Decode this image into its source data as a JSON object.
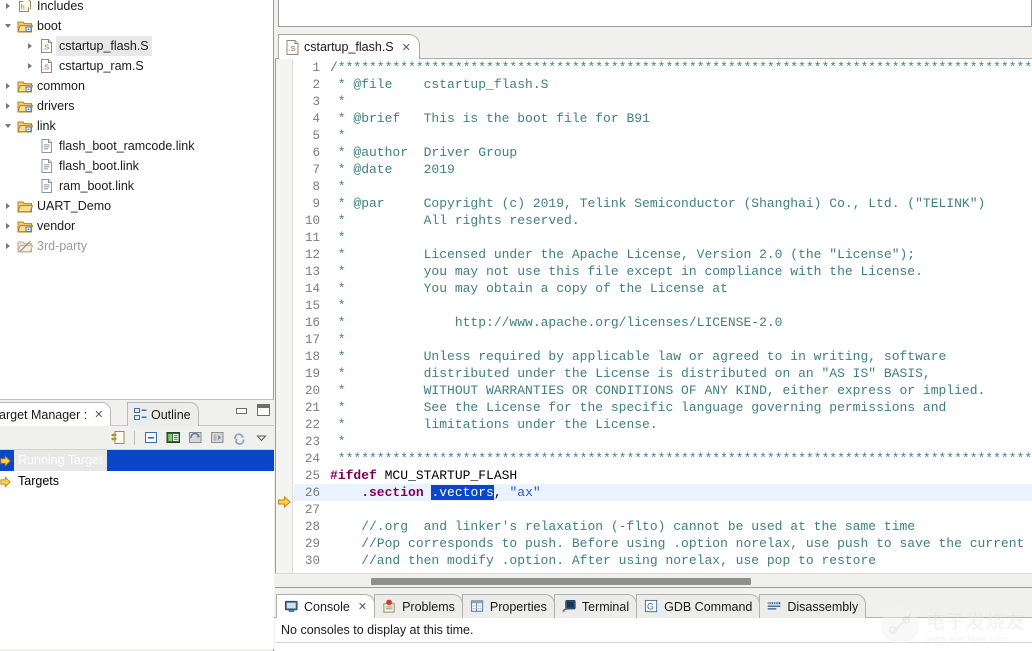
{
  "project_explorer": {
    "items": [
      {
        "label": "Includes",
        "indent": 0,
        "twisty": "right",
        "icon": "includes-icon",
        "selected": false,
        "dim": false
      },
      {
        "label": "boot",
        "indent": 0,
        "twisty": "down",
        "icon": "source-folder-icon",
        "selected": false,
        "dim": false
      },
      {
        "label": "cstartup_flash.S",
        "indent": 1,
        "twisty": "right",
        "icon": "asm-file-icon",
        "selected": true,
        "dim": false
      },
      {
        "label": "cstartup_ram.S",
        "indent": 1,
        "twisty": "right",
        "icon": "asm-file-icon",
        "selected": false,
        "dim": false
      },
      {
        "label": "common",
        "indent": 0,
        "twisty": "right",
        "icon": "source-folder-icon",
        "selected": false,
        "dim": false
      },
      {
        "label": "drivers",
        "indent": 0,
        "twisty": "right",
        "icon": "source-folder-icon",
        "selected": false,
        "dim": false
      },
      {
        "label": "link",
        "indent": 0,
        "twisty": "down",
        "icon": "source-folder-icon",
        "selected": false,
        "dim": false
      },
      {
        "label": "flash_boot_ramcode.link",
        "indent": 1,
        "twisty": "none",
        "icon": "text-file-icon",
        "selected": false,
        "dim": false
      },
      {
        "label": "flash_boot.link",
        "indent": 1,
        "twisty": "none",
        "icon": "text-file-icon",
        "selected": false,
        "dim": false
      },
      {
        "label": "ram_boot.link",
        "indent": 1,
        "twisty": "none",
        "icon": "text-file-icon",
        "selected": false,
        "dim": false
      },
      {
        "label": "UART_Demo",
        "indent": 0,
        "twisty": "right",
        "icon": "folder-icon",
        "selected": false,
        "dim": false
      },
      {
        "label": "vendor",
        "indent": 0,
        "twisty": "right",
        "icon": "source-folder-icon",
        "selected": false,
        "dim": false
      },
      {
        "label": "3rd-party",
        "indent": 0,
        "twisty": "right",
        "icon": "excluded-folder-icon",
        "selected": false,
        "dim": true
      }
    ]
  },
  "bottom_left_view": {
    "tabs": [
      {
        "label": "arget Manager :",
        "icon": "target-manager-icon",
        "active": true,
        "closable": true
      },
      {
        "label": "Outline",
        "icon": "outline-icon",
        "active": false,
        "closable": false
      }
    ],
    "toolbar_icons": [
      "link-with-editor-icon",
      "collapse-all-icon",
      "show-properties-icon",
      "refresh-targets-icon",
      "import-targets-icon",
      "sync-targets-icon",
      "view-menu-icon"
    ],
    "window_buttons": [
      "minimize-button",
      "maximize-button"
    ],
    "tree": [
      {
        "label": "Running Target",
        "icon": "target-arrow-icon",
        "selected": true
      },
      {
        "label": "Targets",
        "icon": "target-arrow-icon",
        "selected": false
      }
    ]
  },
  "editor": {
    "tab": {
      "label": "cstartup_flash.S",
      "icon": "asm-file-icon",
      "close": "╳"
    },
    "current_line": 26,
    "lines": [
      {
        "n": 1,
        "segments": [
          {
            "t": "/*******************************************************************************************",
            "c": "cmt"
          }
        ]
      },
      {
        "n": 2,
        "segments": [
          {
            "t": " * @file    cstartup_flash.S",
            "c": "cmt"
          }
        ]
      },
      {
        "n": 3,
        "segments": [
          {
            "t": " *",
            "c": "cmt"
          }
        ]
      },
      {
        "n": 4,
        "segments": [
          {
            "t": " * @brief   This is the boot file for B91",
            "c": "cmt"
          }
        ]
      },
      {
        "n": 5,
        "segments": [
          {
            "t": " *",
            "c": "cmt"
          }
        ]
      },
      {
        "n": 6,
        "segments": [
          {
            "t": " * @author  Driver Group",
            "c": "cmt"
          }
        ]
      },
      {
        "n": 7,
        "segments": [
          {
            "t": " * @date    2019",
            "c": "cmt"
          }
        ]
      },
      {
        "n": 8,
        "segments": [
          {
            "t": " *",
            "c": "cmt"
          }
        ]
      },
      {
        "n": 9,
        "segments": [
          {
            "t": " * @par     Copyright (c) 2019, Telink Semiconductor (Shanghai) Co., Ltd. (\"TELINK\")",
            "c": "cmt"
          }
        ]
      },
      {
        "n": 10,
        "segments": [
          {
            "t": " *          All rights reserved.",
            "c": "cmt"
          }
        ]
      },
      {
        "n": 11,
        "segments": [
          {
            "t": " *",
            "c": "cmt"
          }
        ]
      },
      {
        "n": 12,
        "segments": [
          {
            "t": " *          Licensed under the Apache License, Version 2.0 (the \"License\");",
            "c": "cmt"
          }
        ]
      },
      {
        "n": 13,
        "segments": [
          {
            "t": " *          you may not use this file except in compliance with the License.",
            "c": "cmt"
          }
        ]
      },
      {
        "n": 14,
        "segments": [
          {
            "t": " *          You may obtain a copy of the License at",
            "c": "cmt"
          }
        ]
      },
      {
        "n": 15,
        "segments": [
          {
            "t": " *",
            "c": "cmt"
          }
        ]
      },
      {
        "n": 16,
        "segments": [
          {
            "t": " *              http://www.apache.org/licenses/LICENSE-2.0",
            "c": "cmt"
          }
        ]
      },
      {
        "n": 17,
        "segments": [
          {
            "t": " *",
            "c": "cmt"
          }
        ]
      },
      {
        "n": 18,
        "segments": [
          {
            "t": " *          Unless required by applicable law or agreed to in writing, software",
            "c": "cmt"
          }
        ]
      },
      {
        "n": 19,
        "segments": [
          {
            "t": " *          distributed under the License is distributed on an \"AS IS\" BASIS,",
            "c": "cmt"
          }
        ]
      },
      {
        "n": 20,
        "segments": [
          {
            "t": " *          WITHOUT WARRANTIES OR CONDITIONS OF ANY KIND, either express or implied.",
            "c": "cmt"
          }
        ]
      },
      {
        "n": 21,
        "segments": [
          {
            "t": " *          See the License for the specific language governing permissions and",
            "c": "cmt"
          }
        ]
      },
      {
        "n": 22,
        "segments": [
          {
            "t": " *          limitations under the License.",
            "c": "cmt"
          }
        ]
      },
      {
        "n": 23,
        "segments": [
          {
            "t": " *",
            "c": "cmt"
          }
        ]
      },
      {
        "n": 24,
        "segments": [
          {
            "t": " *******************************************************************************************",
            "c": "cmt"
          }
        ]
      },
      {
        "n": 25,
        "segments": [
          {
            "t": "#ifdef",
            "c": "pp"
          },
          {
            "t": " MCU_STARTUP_FLASH",
            "c": "id"
          }
        ]
      },
      {
        "n": 26,
        "segments": [
          {
            "t": "    .section",
            "c": "dir"
          },
          {
            "t": " ",
            "c": "id"
          },
          {
            "t": ".vectors",
            "c": "sel"
          },
          {
            "t": ", ",
            "c": "id"
          },
          {
            "t": "\"ax\"",
            "c": "str"
          }
        ]
      },
      {
        "n": 27,
        "segments": [
          {
            "t": "",
            "c": "id"
          }
        ]
      },
      {
        "n": 28,
        "segments": [
          {
            "t": "    //.org  and linker's relaxation (-flto) cannot be used at the same time",
            "c": "cmt"
          }
        ]
      },
      {
        "n": 29,
        "segments": [
          {
            "t": "    //Pop corresponds to push. Before using .option norelax, use push to save the current",
            "c": "cmt"
          }
        ]
      },
      {
        "n": 30,
        "segments": [
          {
            "t": "    //and then modify .option. After using norelax, use pop to restore",
            "c": "cmt"
          }
        ]
      }
    ]
  },
  "bottom_panel": {
    "tabs": [
      {
        "label": "Console",
        "icon": "console-icon",
        "active": true,
        "closable": true
      },
      {
        "label": "Problems",
        "icon": "problems-icon",
        "active": false,
        "closable": false
      },
      {
        "label": "Properties",
        "icon": "properties-icon",
        "active": false,
        "closable": false
      },
      {
        "label": "Terminal",
        "icon": "terminal-icon",
        "active": false,
        "closable": false
      },
      {
        "label": "GDB Command",
        "icon": "gdb-command-icon",
        "active": false,
        "closable": false
      },
      {
        "label": "Disassembly",
        "icon": "disassembly-icon",
        "active": false,
        "closable": false
      }
    ],
    "message": "No consoles to display at this time."
  },
  "watermark": {
    "cn": "电子发烧友",
    "en": "www.elecfans.com"
  },
  "colors": {
    "comment": "#3f7f7f",
    "preprocessor": "#7f0055",
    "string": "#2a57d6",
    "selection": "#0a46c8",
    "current_line": "#eaf2fd",
    "panel_bg": "#f0f0ef"
  }
}
